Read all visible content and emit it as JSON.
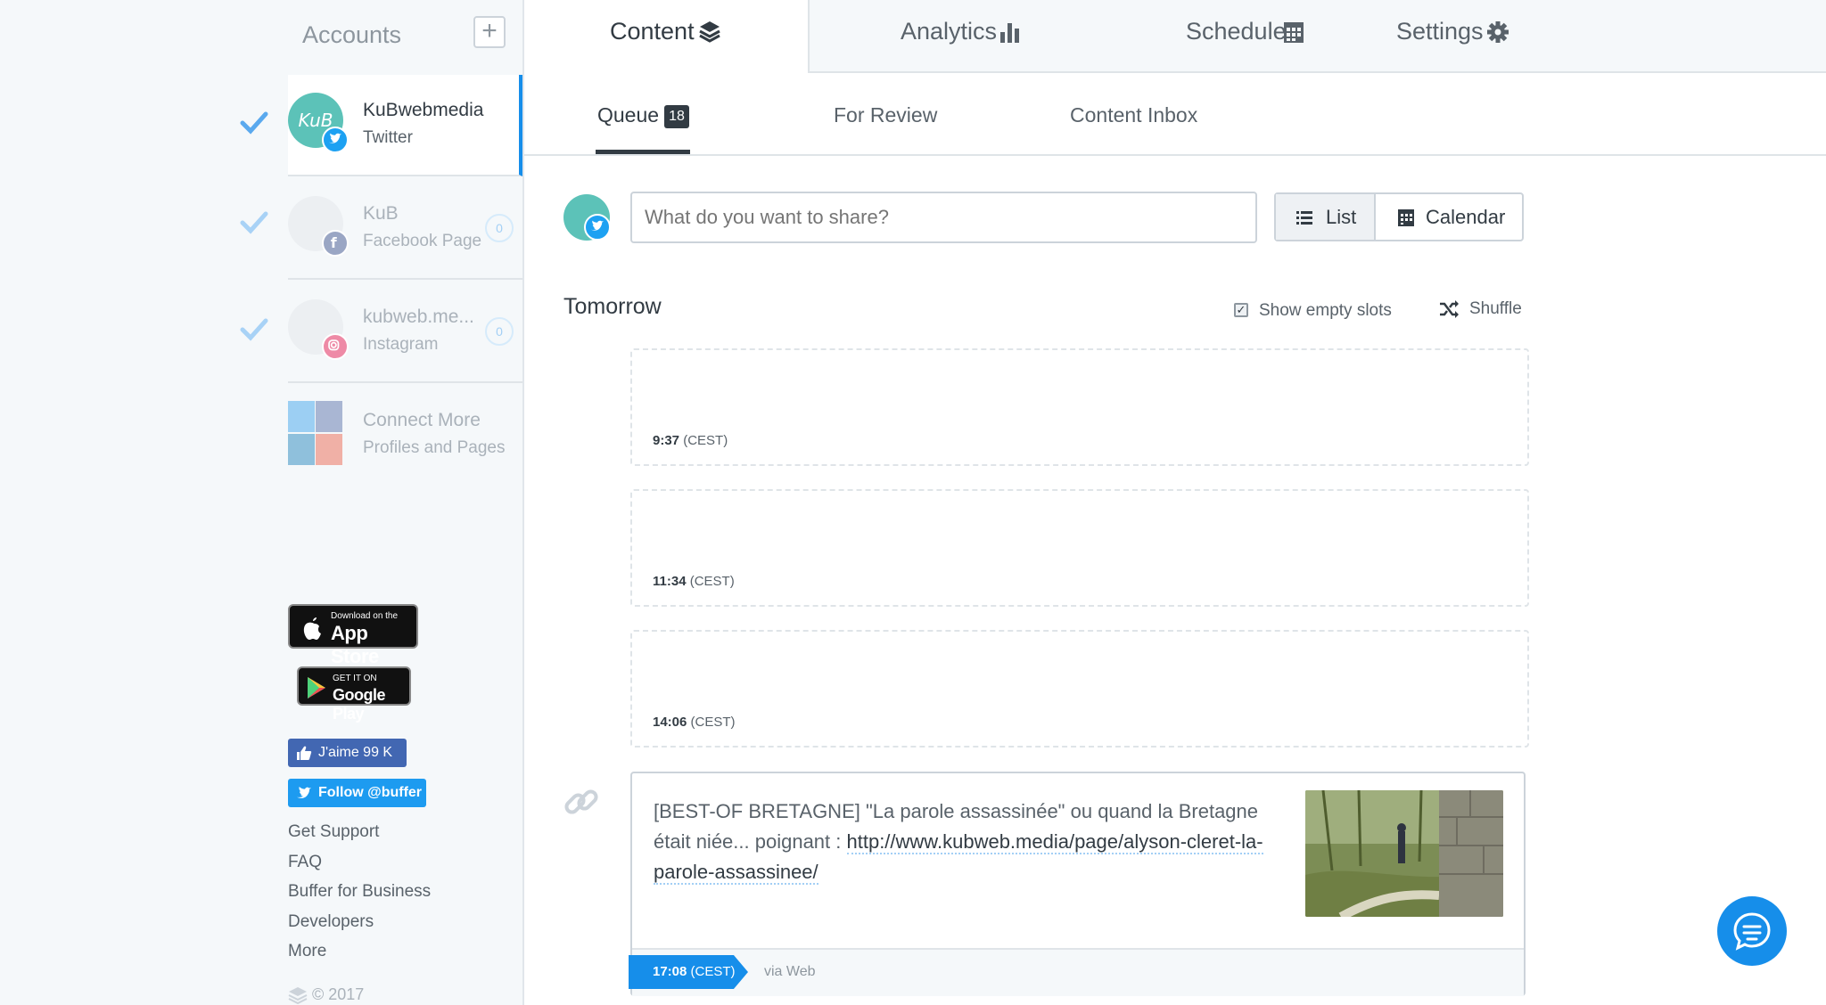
{
  "sidebar": {
    "title": "Accounts",
    "add_label": "+",
    "accounts": [
      {
        "name": "KuBwebmedia",
        "type": "Twitter",
        "count": "",
        "avatar_text": "KuB"
      },
      {
        "name": "KuB",
        "type": "Facebook Page",
        "count": "0"
      },
      {
        "name": "kubweb.me...",
        "type": "Instagram",
        "count": "0"
      }
    ],
    "connect": {
      "title": "Connect More",
      "subtitle": "Profiles and Pages"
    },
    "app_store": {
      "small": "Download on the",
      "big": "App Store"
    },
    "google_play": {
      "small": "GET IT ON",
      "big": "Google Play"
    },
    "fb_like": "J'aime 99 K",
    "tw_follow": "Follow @buffer",
    "links": [
      "Get Support",
      "FAQ",
      "Buffer for Business",
      "Developers",
      "More"
    ],
    "copyright": "© 2017"
  },
  "tabs": [
    {
      "label": "Content",
      "icon": "layers-icon"
    },
    {
      "label": "Analytics",
      "icon": "bar-chart-icon"
    },
    {
      "label": "Schedule",
      "icon": "calendar-icon"
    },
    {
      "label": "Settings",
      "icon": "gear-icon"
    }
  ],
  "subtabs": {
    "queue": "Queue",
    "queue_count": "18",
    "review": "For Review",
    "inbox": "Content Inbox"
  },
  "composer": {
    "placeholder": "What do you want to share?"
  },
  "view": {
    "list": "List",
    "calendar": "Calendar"
  },
  "queue": {
    "day": "Tomorrow",
    "show_empty": "Show empty slots",
    "shuffle": "Shuffle",
    "slots": [
      {
        "time": "9:37",
        "tz": "(CEST)"
      },
      {
        "time": "11:34",
        "tz": "(CEST)"
      },
      {
        "time": "14:06",
        "tz": "(CEST)"
      }
    ],
    "post": {
      "text": "[BEST-OF BRETAGNE]  \"La parole assassinée\" ou quand la Bretagne était niée... poignant : ",
      "link": "http://www.kubweb.media/page/alyson-cleret-la-parole-assassinee/",
      "time": "17:08",
      "tz": "(CEST)",
      "via": "via Web"
    }
  },
  "colors": {
    "accent": "#168eea",
    "twitter": "#1da1f2",
    "facebook": "#3b5998",
    "instagram": "#e1306c",
    "avatar": "#5cc2b8"
  }
}
